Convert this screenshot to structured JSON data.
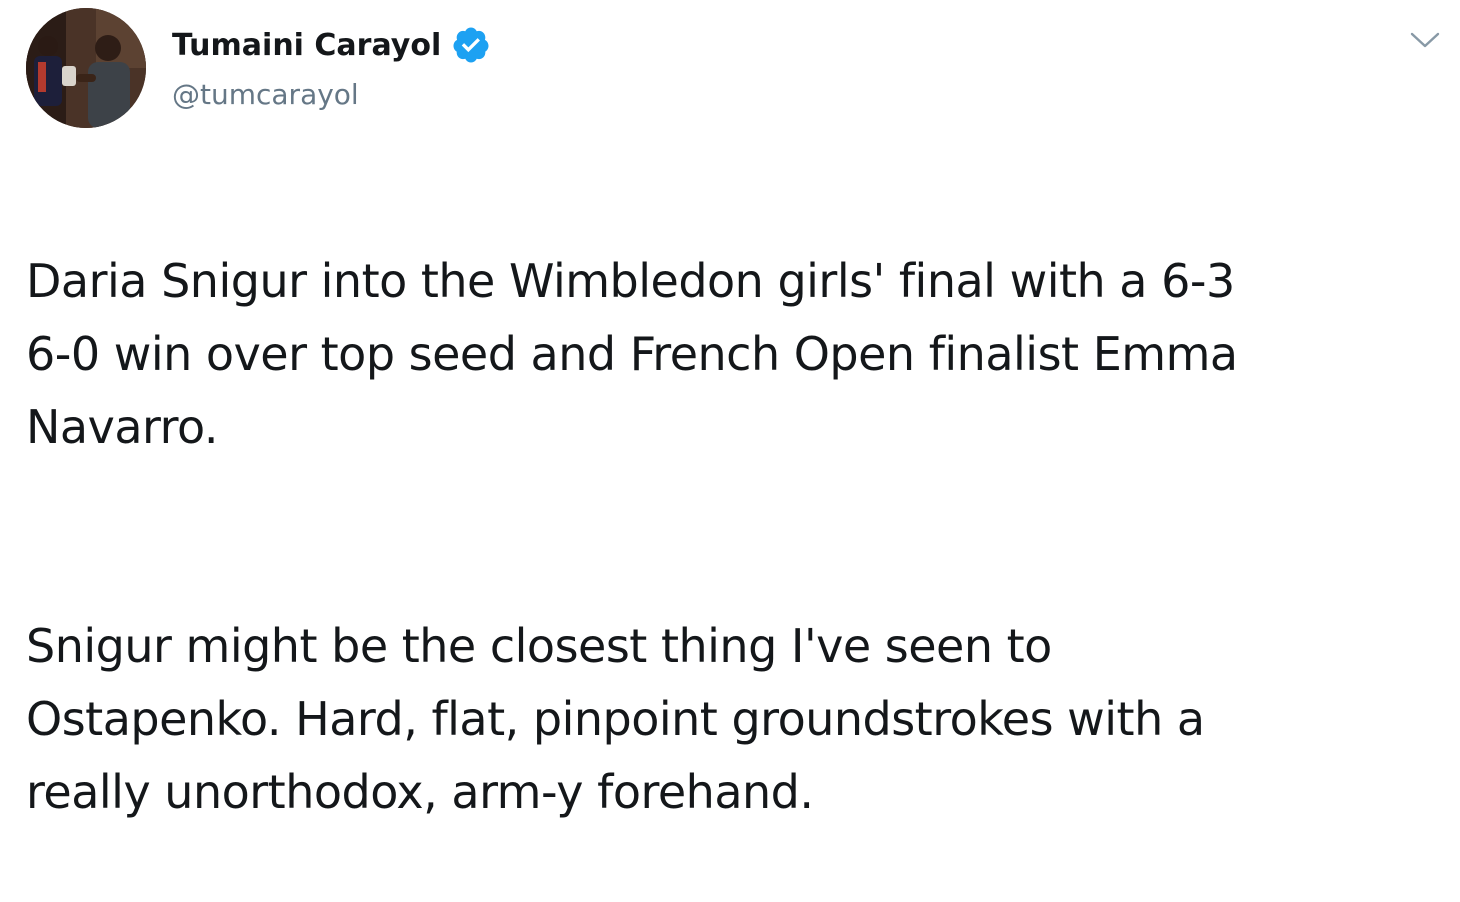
{
  "user": {
    "display_name": "Tumaini Carayol",
    "handle": "@tumcarayol",
    "verified": true
  },
  "tweet": {
    "paragraphs": [
      "Daria Snigur into the Wimbledon girls' final with a 6-3\n6-0 win over top seed and French Open finalist Emma\nNavarro.",
      "Snigur might be the closest thing I've seen to\nOstapenko. Hard, flat, pinpoint groundstrokes with a\nreally unorthodox, arm-y forehand."
    ]
  },
  "icons": {
    "verified": "verified-badge-icon",
    "menu": "chevron-down-icon"
  },
  "colors": {
    "verified_blue": "#1da1f2",
    "handle_gray": "#657786",
    "text": "#14171a"
  }
}
